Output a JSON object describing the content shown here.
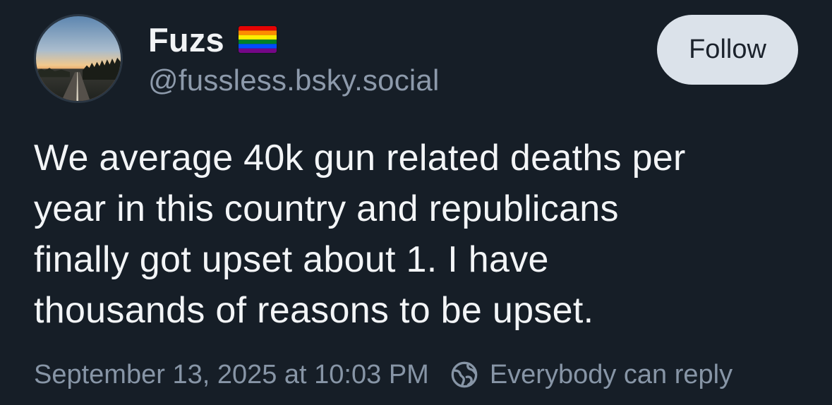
{
  "author": {
    "display_name": "Fuzs",
    "name_emoji": "rainbow-flag-icon",
    "handle": "@fussless.bsky.social",
    "avatar": "road-sunset-avatar"
  },
  "follow_button": {
    "label": "Follow"
  },
  "post": {
    "text_lines": [
      "We average 40k gun related deaths per",
      "year in this country and republicans",
      "finally got upset about 1. I have",
      "thousands of reasons to be upset."
    ]
  },
  "meta": {
    "timestamp": "September 13, 2025 at 10:03 PM",
    "reply_icon": "earth-icon",
    "reply_setting": "Everybody can reply"
  },
  "colors": {
    "background": "#161e27",
    "primary_text": "#f1f3f5",
    "secondary_text": "#8795a6",
    "button_bg": "#dbe2ea",
    "button_text": "#1b222c"
  }
}
